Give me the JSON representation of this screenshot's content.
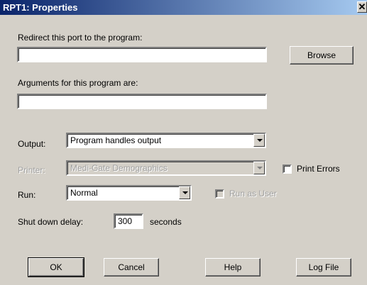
{
  "window": {
    "title": "RPT1: Properties",
    "close_glyph": "✕"
  },
  "redirect": {
    "label": "Redirect this port to the program:",
    "value": "",
    "browse_label": "Browse"
  },
  "arguments": {
    "label": "Arguments for this program are:",
    "value": ""
  },
  "output": {
    "label": "Output:",
    "value": "Program handles output"
  },
  "printer": {
    "label": "Printer:",
    "value": "Medi-Gate Demographics"
  },
  "print_errors": {
    "label": "Print Errors",
    "checked": false
  },
  "run": {
    "label": "Run:",
    "value": "Normal"
  },
  "run_as_user": {
    "label": "Run as User",
    "checked": false
  },
  "shutdown": {
    "label": "Shut down delay:",
    "value": "300",
    "unit": "seconds"
  },
  "buttons": {
    "ok": "OK",
    "cancel": "Cancel",
    "help": "Help",
    "log_file": "Log File"
  }
}
